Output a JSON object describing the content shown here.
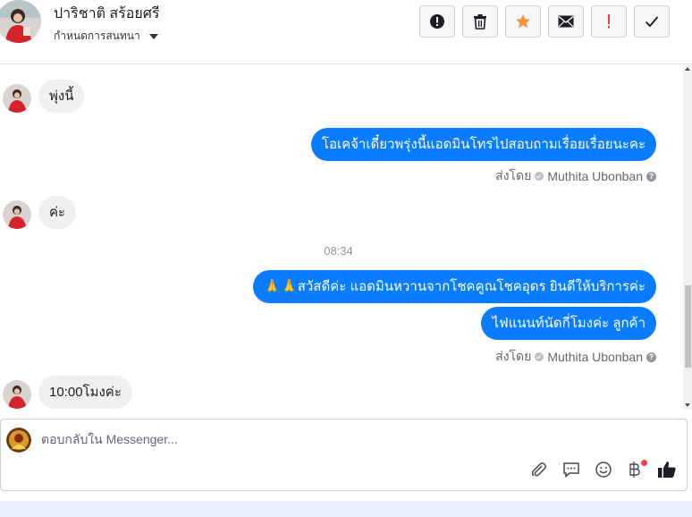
{
  "header": {
    "contact_name": "ปาริชาติ สร้อยศรี",
    "conversation_actions_label": "กำหนดการสนทนา",
    "toolbar": [
      {
        "name": "report-spam-button",
        "icon": "alert-circle-icon",
        "color": "#4b4f56"
      },
      {
        "name": "delete-button",
        "icon": "trash-icon",
        "color": "#4b4f56"
      },
      {
        "name": "star-button",
        "icon": "star-icon",
        "color": "#f7923b"
      },
      {
        "name": "mark-unread-button",
        "icon": "envelope-icon",
        "color": "#4b4f56"
      },
      {
        "name": "follow-up-button",
        "icon": "exclamation-icon",
        "color": "#fa3e3e"
      },
      {
        "name": "mark-done-button",
        "icon": "check-icon",
        "color": "#4b4f56"
      }
    ]
  },
  "messages": {
    "m1": "พุ่งนี้",
    "m2": "โอเคจ้าเดี๋ยวพรุ่งนี้แอดมินโทรไปสอบถามเรื่อยเรื่อยนะคะ",
    "sent_by_1": {
      "prefix": "ส่งโดย",
      "agent": "Muthita Ubonban"
    },
    "m3": "ค่ะ",
    "time_separator": "08:34",
    "m4": "🙏🙏สวัสดีค่ะ แอดมินหวานจากโชคคูณโชคอุดร ยินดีให้บริการค่ะ",
    "m5": "ไฟแนนท์นัดกี่โมงค่ะ ลูกค้า",
    "sent_by_2": {
      "prefix": "ส่งโดย",
      "agent": "Muthita Ubonban"
    },
    "m6": "10:00โมงค่ะ"
  },
  "composer": {
    "placeholder": "ตอบกลับใน Messenger...",
    "tools": [
      "paperclip-icon",
      "saved-reply-icon",
      "emoji-icon",
      "baht-payment-icon",
      "thumbs-up-icon"
    ]
  },
  "colors": {
    "outgoing_bubble": "#0a7cff",
    "incoming_bubble": "#f0f0f0",
    "accent_star": "#f7923b",
    "alert_red": "#fa3e3e"
  }
}
